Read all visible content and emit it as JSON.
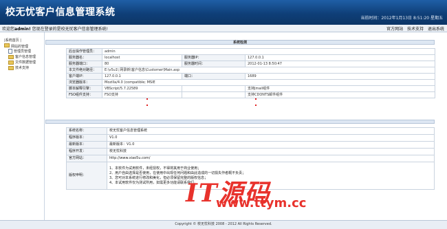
{
  "header": {
    "app_title": "校无忧客户信息管理系统",
    "datetime": "当前时间：2012年1月13日 8:51:20 星期五"
  },
  "topbar": {
    "welcome_prefix": "欢迎您",
    "user": "admin!",
    "welcome_suffix": "您现在登录的是校无忧客户信息管理系统!",
    "links": [
      "官方网站",
      "技术支持",
      "退出系统"
    ]
  },
  "sidebar": {
    "home": "|系统首页 |",
    "root": "网站的管理",
    "items": [
      "管理员管理",
      "客户信息管理",
      "文件数据管理",
      "技术支持"
    ]
  },
  "system_check": {
    "title": "系统检测",
    "row1": {
      "label": "后台操作管理员：",
      "value": "admin"
    },
    "row2": {
      "label": "服务器名：",
      "value": "localhost",
      "label2": "服务器IP：",
      "value2": "127.0.0.1"
    },
    "row3": {
      "label": "服务器端口：",
      "value": "80",
      "label2": "服务器时间：",
      "value2": "2012-01-13 8:50:47"
    },
    "row4": {
      "label": "本文件绝对路径：",
      "value": "E:\\v5u1\\ 网录新\\客户信息\\Customer\\Main.asp"
    },
    "row5": {
      "label": "客户端IP：",
      "value": "127.0.0.1",
      "label2": "端口：",
      "value2": "1689"
    },
    "row6": {
      "label": "浏览器版本：",
      "value": "Mozilla/4.0 (compatible; MSIE"
    },
    "row7": {
      "label": "脚本解释引擎：",
      "value": "VBScript/5.7.22589",
      "value2": "支持Jmail组件"
    },
    "row8": {
      "label": "FSO组件支持：",
      "value": "FSO支持",
      "value2": "支持CDONTS邮件组件"
    }
  },
  "about": {
    "rows": [
      {
        "label": "系统名称：",
        "value": "校无忧客户信息管理系统"
      },
      {
        "label": "程序版本：",
        "value": "V1.0"
      },
      {
        "label": "最新版本：",
        "value": "最新版本：V1.0"
      },
      {
        "label": "程序开发：",
        "value": "校无忧科技"
      },
      {
        "label": "官方网站：",
        "value": "http://www.xiao5u.com/"
      }
    ],
    "disclaimer_label": "版权申明：",
    "disclaimer": [
      "1、本软件为试用软件，未经授权，不得将其用于商业使用；",
      "2、用户自由选择是否使用，在使用中出现任何问题和由此造成的一切损失作者概不负责；",
      "3、您可对本系统进行修改和美化，但必须保留完整的版权信息；",
      "4、本试用软件仅为测试所用，如需更多功能请联系我们。"
    ]
  },
  "footer": {
    "copyright": "Copyright © 校无忧科技 2008 - 2012 All Rights Reserved."
  },
  "watermark": {
    "line1": "IT源码",
    "line2": "www.ttym.cc"
  }
}
